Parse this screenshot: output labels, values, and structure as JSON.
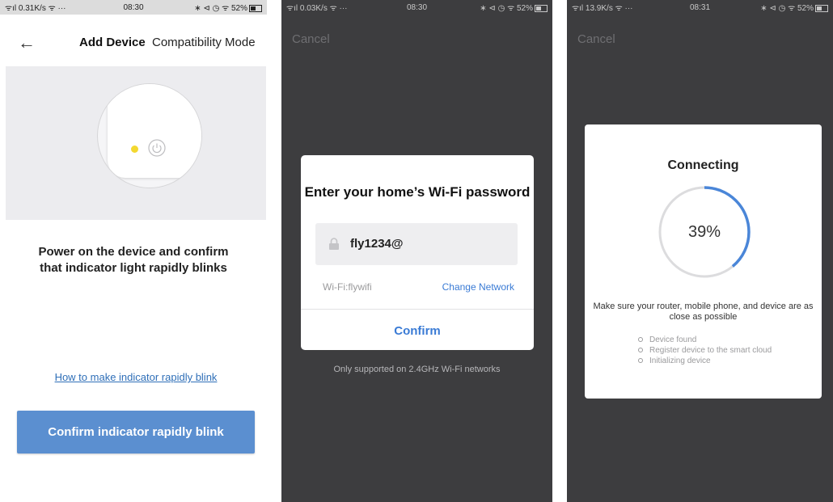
{
  "panel1": {
    "status": {
      "left": "ᯤıl 0.31K/s ᯤ ···",
      "time": "08:30",
      "right": "∗ ⊲ ◷ ᯤ 52%"
    },
    "header": {
      "back_icon": "arrow-left-icon",
      "title": "Add Device",
      "mode": "Compatibility Mode"
    },
    "illustration": {
      "led_color": "#f3d830",
      "icon": "power-icon"
    },
    "instruction": [
      "Power on the device and confirm",
      "that indicator light rapidly blinks"
    ],
    "help_link": "How to make indicator rapidly blink",
    "confirm_button": "Confirm indicator rapidly blink",
    "accent": "#5b8fd0"
  },
  "panel2": {
    "status": {
      "left": "ᯤıl 0.03K/s ᯤ ···",
      "time": "08:30",
      "right": "∗ ⊲ ◷ ᯤ 52%"
    },
    "cancel": "Cancel",
    "modal": {
      "title": "Enter your home’s Wi-Fi password",
      "password_value": "fly1234@",
      "lock_icon": "lock-icon",
      "wifi_label": "Wi-Fi:flywifi",
      "change_network": "Change Network",
      "confirm": "Confirm"
    },
    "note": "Only supported on 2.4GHz Wi-Fi networks",
    "link_color": "#3a7bd5"
  },
  "panel3": {
    "status": {
      "left": "ᯤıl 13.9K/s ᯤ ···",
      "time": "08:31",
      "right": "∗ ⊲ ◷ ᯤ 52%"
    },
    "cancel": "Cancel",
    "modal": {
      "title": "Connecting",
      "percent_text": "39%",
      "progress_fraction": 0.39,
      "message": "Make sure your router, mobile phone, and device are as close as possible",
      "steps": [
        "Device found",
        "Register device to the smart cloud",
        "Initializing device"
      ]
    },
    "progress_color": "#4a86d8"
  }
}
